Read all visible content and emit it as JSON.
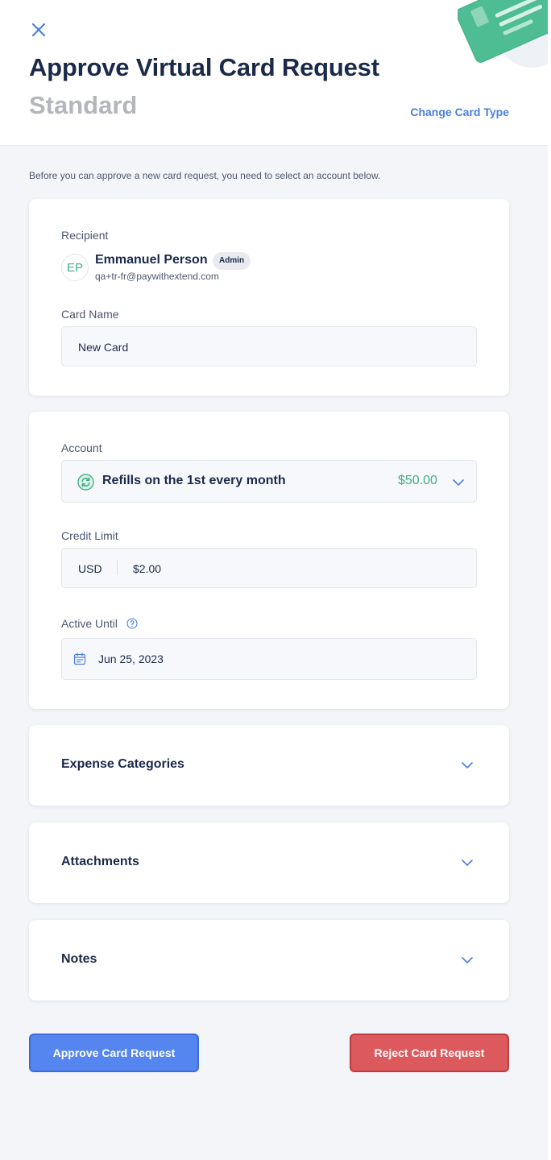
{
  "header": {
    "title": "Approve Virtual Card Request",
    "subtitle": "Standard",
    "change_card_type": "Change Card Type"
  },
  "intro": "Before you can approve a new card request, you need to select an account below.",
  "recipient": {
    "label": "Recipient",
    "initials": "EP",
    "name": "Emmanuel Person",
    "role": "Admin",
    "email": "qa+tr-fr@paywithextend.com"
  },
  "card_name": {
    "label": "Card Name",
    "value": "New Card"
  },
  "account": {
    "label": "Account",
    "selected": "Refills on the 1st every month",
    "amount": "$50.00"
  },
  "credit_limit": {
    "label": "Credit Limit",
    "currency": "USD",
    "value": "$2.00"
  },
  "active_until": {
    "label": "Active Until",
    "value": "Jun 25, 2023"
  },
  "sections": {
    "expense_categories": "Expense Categories",
    "attachments": "Attachments",
    "notes": "Notes"
  },
  "actions": {
    "approve": "Approve Card Request",
    "reject": "Reject Card Request"
  },
  "colors": {
    "primary": "#4a7fe0",
    "approve_button": "#5585ee",
    "reject_button": "#dc5a5e",
    "accent_green": "#3fae84",
    "title_text": "#1c2a4a",
    "page_background": "#f3f5f9"
  },
  "icons": {
    "close": "close-icon",
    "refresh": "refresh-icon",
    "calendar": "calendar-icon",
    "help": "help-icon",
    "chevron": "chevron-down-icon"
  }
}
